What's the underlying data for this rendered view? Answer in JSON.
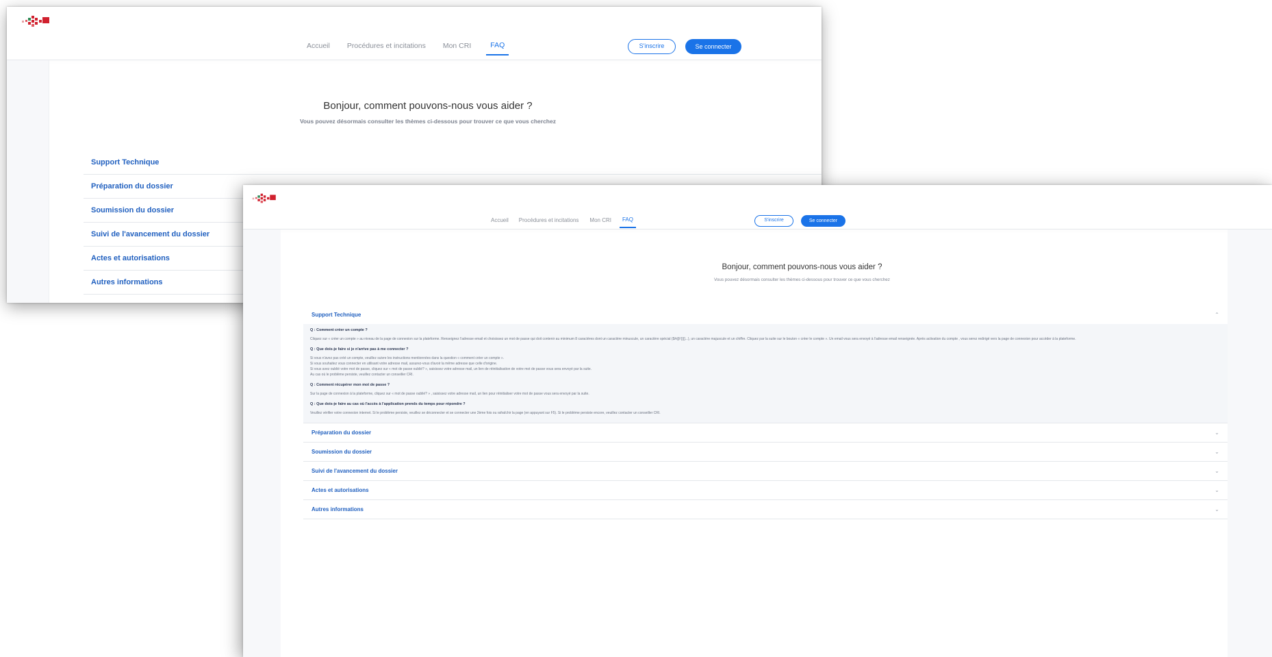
{
  "nav": {
    "items": [
      "Accueil",
      "Procédures et incitations",
      "Mon CRI",
      "FAQ"
    ],
    "active": "FAQ"
  },
  "auth": {
    "signup_label": "S'inscrire",
    "login_label": "Se connecter"
  },
  "hero": {
    "title": "Bonjour, comment pouvons-nous vous aider ?",
    "subtitle": "Vous pouvez désormais consulter les thèmes ci-dessous pour trouver ce que vous cherchez"
  },
  "categories": [
    "Support Technique",
    "Préparation du dossier",
    "Soumission du dossier",
    "Suivi de l'avancement du dossier",
    "Actes et autorisations",
    "Autres informations"
  ],
  "support_faq": [
    {
      "q": "Q : Comment créer un compte ?",
      "a": "Cliquez sur « créer un compte » au niveau de la page de connexion sur la plateforme. Renseignez l'adresse email et choisissez un mot de passe qui doit contenir au minimum 8 caractères dont un caractère minuscule, un caractère spécial ($#@!{}[]...), un caractère majuscule et un chiffre. Cliquez par la suite sur le bouton « créer le compte ». Un email vous sera envoyé à l'adresse email renseignée. Après activation du compte , vous serez redirigé vers la page de connexion pour accéder à la plateforme."
    },
    {
      "q": "Q : Que dois-je faire si je n'arrive pas à me connecter ?",
      "a": "Si vous n'avez pas créé un compte, veuillez suivre les instructions mentionnées dans la question « comment créer un compte ».\nSi vous souhaitez vous connecter en utilisant votre adresse mail, assurez-vous d'avoir la même adresse que celle d'origine.\nSi vous avez oublié votre mot de passe, cliquez sur « mot de passe oublié? », saisissez votre adresse mail, un lien de réinitialisation de votre mot de passe vous sera envoyé par la suite.\nAu cas où le problème persiste, veuillez contacter un conseiller CRI."
    },
    {
      "q": "Q : Comment récupérer mon mot de passe ?",
      "a": "Sur la page de connexion à la plateforme, cliquez sur « mot de passe oublié? » , saisissez votre adresse mail, un lien pour réinitialiser votre mot de passe vous sera envoyé par la suite."
    },
    {
      "q": "Q : Que dois-je faire au cas où l'accès à l'application prends du temps pour répondre ?",
      "a": "Veuillez vérifier votre connexion internet. Si le problème persiste, veuillez se déconnecter et se connecter une 2ème fois ou rafraîchir la page (en appuyant sur F5). Si le problème persiste encore, veuillez contacter un conseiller CRI."
    }
  ],
  "icons": {
    "expanded": "chevron-up-icon",
    "collapsed": "chevron-down-icon"
  },
  "colors": {
    "accent": "#1a73e8",
    "category_text": "#1f5fbf",
    "logo_red": "#d0202e"
  }
}
